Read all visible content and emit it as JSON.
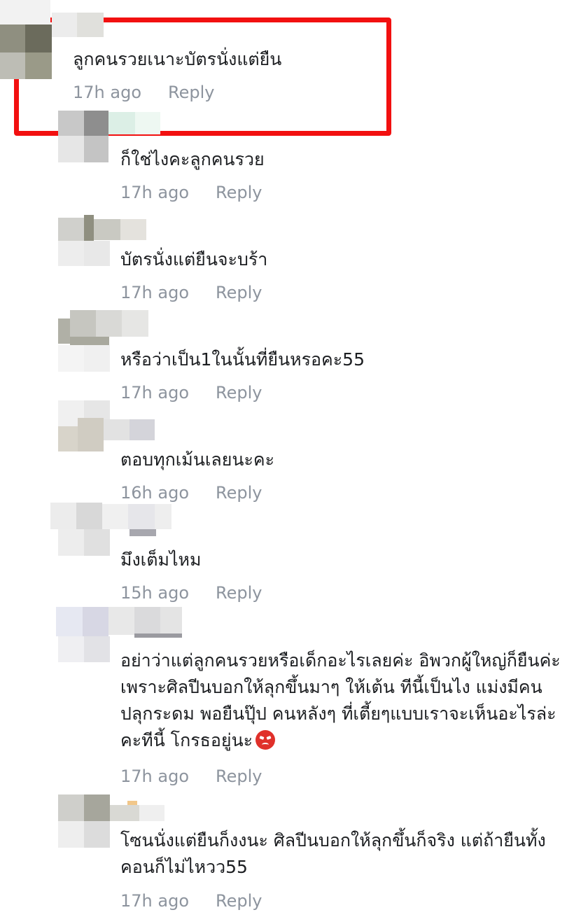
{
  "comments": [
    {
      "text": "ลูกคนรวยเนาะบัตรนั่งแต่ยืน",
      "time": "17h ago",
      "reply": "Reply"
    },
    {
      "text": "ก็ใช่ไงคะลูกคนรวย",
      "time": "17h ago",
      "reply": "Reply"
    },
    {
      "text": "บัตรนั่งแต่ยืนจะบร้า",
      "time": "17h ago",
      "reply": "Reply"
    },
    {
      "text": "หรือว่าเป็น1ในนั้นที่ยืนหรอคะ55",
      "time": "17h ago",
      "reply": "Reply"
    },
    {
      "text": "ตอบทุกเม้นเลยนะคะ",
      "time": "16h ago",
      "reply": "Reply"
    },
    {
      "text": "มึงเต็มไหม",
      "time": "15h ago",
      "reply": "Reply"
    },
    {
      "text": "อย่าว่าแต่ลูกคนรวยหรือเด็กอะไรเลยค่ะ อิพวกผู้ใหญ่ก็ยืนค่ะ เพราะศิลปีนบอกให้ลุกขึ้นมาๆ ให้เต้น ทีนี้เป็นไง แม่งมีคนปลุกระดม พอยืนปุ๊ป คนหลังๆ ที่เตี้ยๆแบบเราจะเห็นอะไรล่ะคะทีนี้ โกรธอยู่นะ",
      "time": "17h ago",
      "reply": "Reply",
      "emoji": "angry-face"
    },
    {
      "text": "โซนนั่งแต่ยืนก็งงนะ ศิลปีนบอกให้ลุกขึ้นก็จริง แต่ถ้ายืนทั้งคอนก็ไม่ไหวว55",
      "time": "17h ago",
      "reply": "Reply"
    }
  ]
}
